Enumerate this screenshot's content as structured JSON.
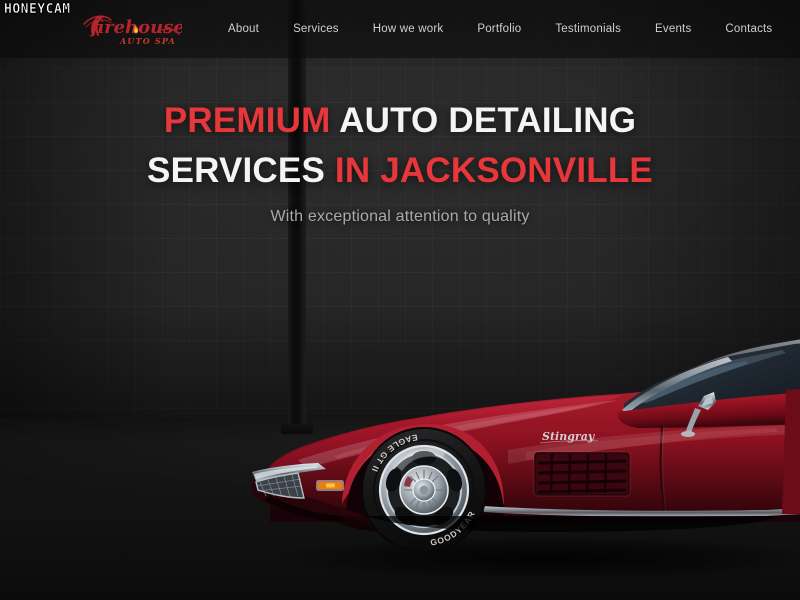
{
  "site": {
    "brand_name": "Firehouse",
    "brand_tagline": "AUTO SPA",
    "accent_color": "#e8373a",
    "background_color": "#242424"
  },
  "watermark": {
    "label": "HONEYCAM"
  },
  "header": {
    "nav": [
      {
        "label": "About"
      },
      {
        "label": "Services"
      },
      {
        "label": "How we work"
      },
      {
        "label": "Portfolio"
      },
      {
        "label": "Testimonials"
      },
      {
        "label": "Events"
      },
      {
        "label": "Contacts"
      }
    ]
  },
  "hero": {
    "line1_red": "PREMIUM",
    "line1_white": " AUTO DETAILING",
    "line2_white": "SERVICES",
    "line2_red": " IN JACKSONVILLE",
    "subtitle": "With exceptional attention to quality"
  },
  "scene": {
    "car_badge": "Stingray",
    "tire_brand": "GOODYEAR",
    "tire_model": "EAGLE GT II",
    "car_color": "#9e1420",
    "wall_type": "dark-brick",
    "floor_color": "#111111"
  }
}
